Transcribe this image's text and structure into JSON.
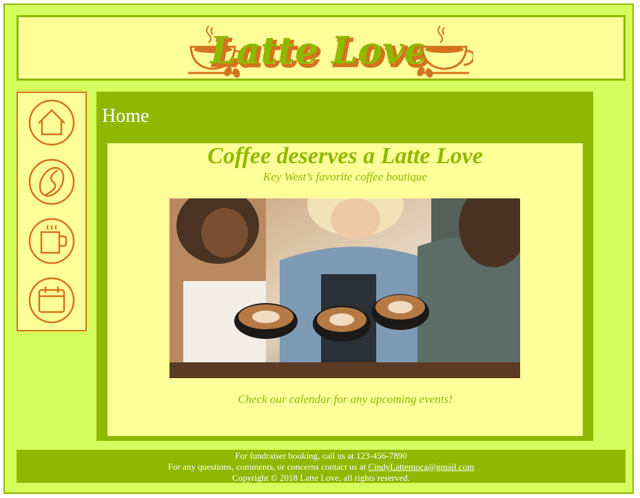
{
  "header": {
    "logo_text": "Latte Love",
    "colors": {
      "accent_orange": "#d4731f",
      "brand_green": "#8fb800",
      "cream": "#ffff99",
      "lime": "#d4ff5c"
    }
  },
  "nav": {
    "items": [
      {
        "icon": "home-icon"
      },
      {
        "icon": "coffee-bean-icon"
      },
      {
        "icon": "coffee-mug-icon"
      },
      {
        "icon": "calendar-icon"
      }
    ]
  },
  "main": {
    "title": "Home",
    "headline": "Coffee deserves a Latte Love",
    "tagline": "Key West’s favorite coffee boutique",
    "events_text": "Check our calendar for any upcoming events!"
  },
  "footer": {
    "line1": "For fundraiser booking, call us at 123-456-7890",
    "line2_prefix": "For any questions, comments, or concerns contact us at ",
    "email": "CindyLattemoca@gmail.com",
    "line3": "Copyright © 2018 Latte Love, all rights reserved."
  }
}
